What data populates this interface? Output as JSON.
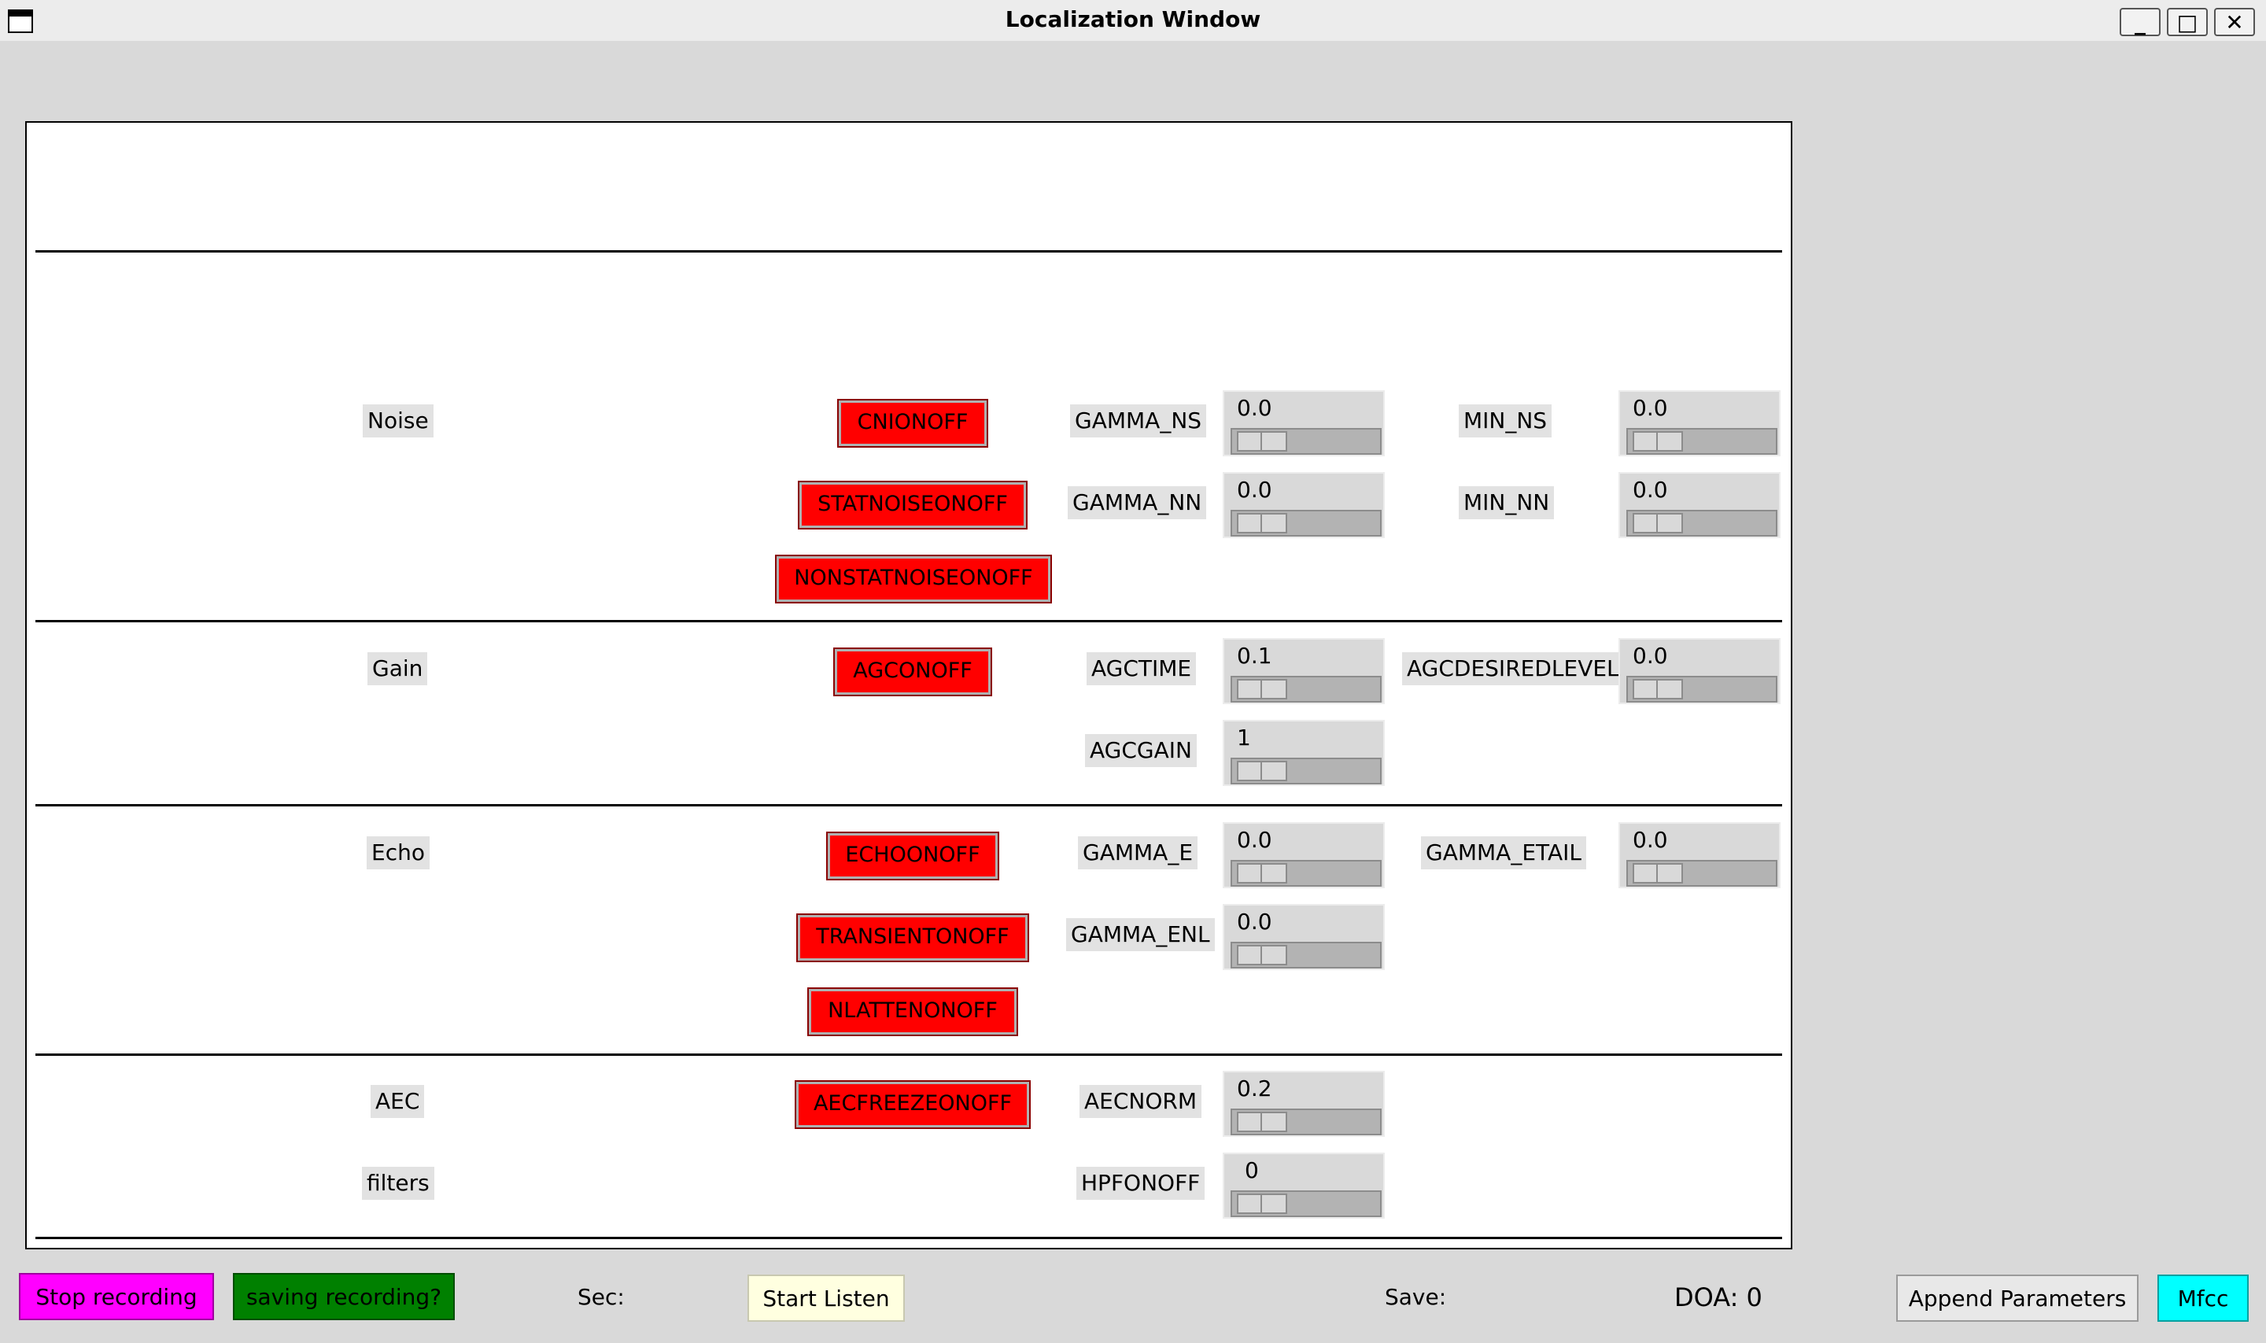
{
  "window": {
    "title": "Localization Window",
    "minimize": "_",
    "maximize": "□",
    "close": "✕"
  },
  "sections": {
    "noise": {
      "label": "Noise",
      "buttons": [
        "CNIONOFF",
        "STATNOISEONOFF",
        "NONSTATNOISEONOFF"
      ],
      "params": {
        "gamma_ns": {
          "label": "GAMMA_NS",
          "value": "0.0"
        },
        "gamma_nn": {
          "label": "GAMMA_NN",
          "value": "0.0"
        },
        "min_ns": {
          "label": "MIN_NS",
          "value": "0.0"
        },
        "min_nn": {
          "label": "MIN_NN",
          "value": "0.0"
        }
      }
    },
    "gain": {
      "label": "Gain",
      "buttons": [
        "AGCONOFF"
      ],
      "params": {
        "agctime": {
          "label": "AGCTIME",
          "value": "0.1"
        },
        "agcgain": {
          "label": "AGCGAIN",
          "value": "1"
        },
        "agcdesiredlevel": {
          "label": "AGCDESIREDLEVEL",
          "value": "0.0"
        }
      }
    },
    "echo": {
      "label": "Echo",
      "buttons": [
        "ECHOONOFF",
        "TRANSIENTONOFF",
        "NLATTENONOFF"
      ],
      "params": {
        "gamma_e": {
          "label": "GAMMA_E",
          "value": "0.0"
        },
        "gamma_enl": {
          "label": "GAMMA_ENL",
          "value": "0.0"
        },
        "gamma_etail": {
          "label": "GAMMA_ETAIL",
          "value": "0.0"
        }
      }
    },
    "aec": {
      "label": "AEC",
      "buttons": [
        "AECFREEZEONOFF"
      ],
      "params": {
        "aecnorm": {
          "label": "AECNORM",
          "value": "0.2"
        }
      }
    },
    "filters": {
      "label": "filters",
      "params": {
        "hpfonoff": {
          "label": "HPFONOFF",
          "value": "0"
        }
      }
    }
  },
  "bottom": {
    "stop_recording": "Stop  recording",
    "saving_recording": "saving recording?",
    "sec_label": "Sec:",
    "start_listen": "Start Listen",
    "save_label": "Save:",
    "doa": "DOA: 0",
    "append_parameters": "Append Parameters",
    "mfcc": "Mfcc"
  },
  "colors": {
    "red_button": "#ff0000",
    "stop_button": "#ff00ff",
    "saving_button": "#008000",
    "start_listen": "#ffffe0",
    "mfcc": "#00ffff"
  }
}
